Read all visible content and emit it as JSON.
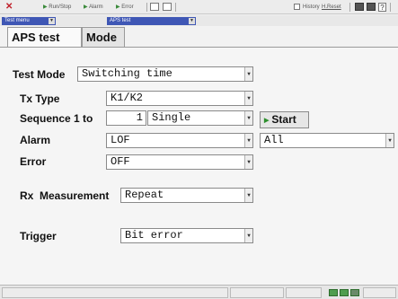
{
  "toolbar": {
    "run_stop": "Run/Stop",
    "alarm": "Alarm",
    "error": "Error",
    "history": "History",
    "reset": "H.Reset",
    "help": "?"
  },
  "menubar": {
    "test_menu": "Test menu",
    "aps_test": "APS test"
  },
  "tabs": [
    {
      "label": "APS test"
    },
    {
      "label": "Mode"
    }
  ],
  "form": {
    "test_mode": {
      "label": "Test Mode",
      "value": "Switching time"
    },
    "tx_type": {
      "label": "Tx Type",
      "value": "K1/K2"
    },
    "sequence": {
      "label": "Sequence 1 to",
      "count": "1",
      "mode": "Single"
    },
    "start": "Start",
    "alarm": {
      "label": "Alarm",
      "value": "LOF",
      "secondary": "All"
    },
    "error": {
      "label": "Error",
      "value": "OFF"
    },
    "rx_measurement": {
      "label": "Rx  Measurement",
      "value": "Repeat"
    },
    "trigger": {
      "label": "Trigger",
      "value": "Bit error"
    }
  },
  "colors": {
    "accent_blue": "#3f57b5",
    "start_green": "#2d8f2d",
    "logo_red": "#c0202a"
  }
}
